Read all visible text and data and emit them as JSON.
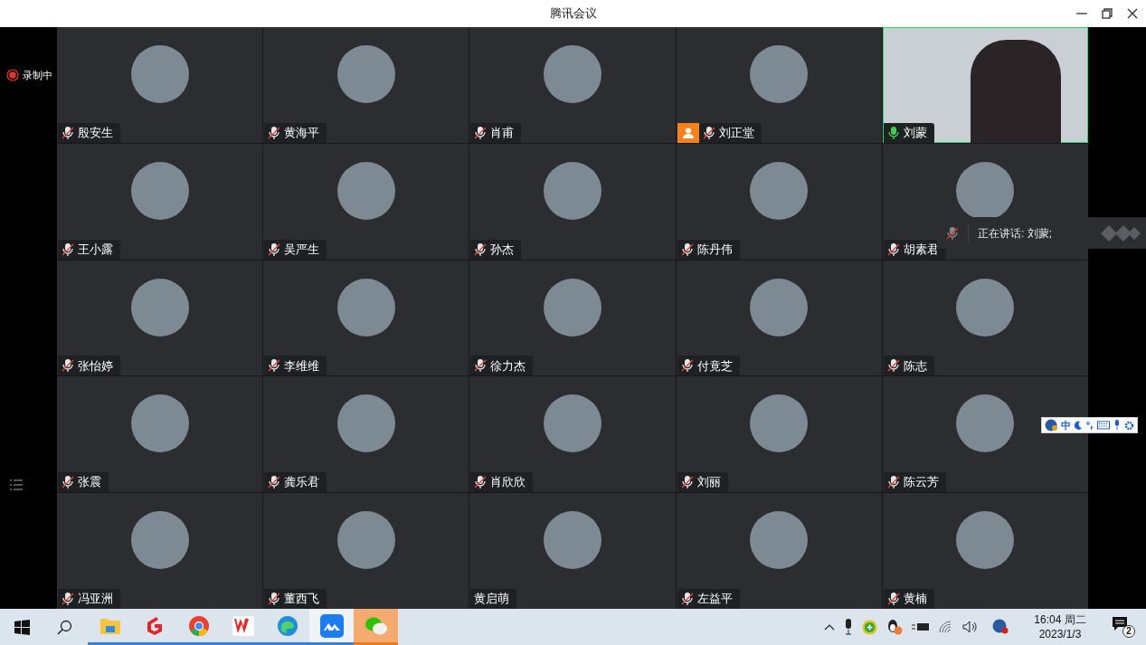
{
  "window": {
    "title": "腾讯会议"
  },
  "recording": {
    "label": "录制中",
    "on": true
  },
  "tiles": [
    {
      "name": "殷安生",
      "kind": "avatar",
      "audio": true,
      "muted": true,
      "host": false,
      "speaking": false
    },
    {
      "name": "黄海平",
      "kind": "avatar",
      "audio": true,
      "muted": true,
      "host": false,
      "speaking": false
    },
    {
      "name": "肖甫",
      "kind": "avatar",
      "audio": true,
      "muted": true,
      "host": false,
      "speaking": false
    },
    {
      "name": "刘正堂",
      "kind": "avatar",
      "audio": true,
      "muted": true,
      "host": true,
      "speaking": false
    },
    {
      "name": "刘蒙",
      "kind": "video",
      "audio": true,
      "muted": false,
      "host": false,
      "speaking": true
    },
    {
      "name": "王小露",
      "kind": "avatar",
      "audio": true,
      "muted": true,
      "host": false,
      "speaking": false
    },
    {
      "name": "吴严生",
      "kind": "avatar",
      "audio": true,
      "muted": true,
      "host": false,
      "speaking": false
    },
    {
      "name": "孙杰",
      "kind": "avatar",
      "audio": true,
      "muted": true,
      "host": false,
      "speaking": false
    },
    {
      "name": "陈丹伟",
      "kind": "avatar",
      "audio": true,
      "muted": true,
      "host": false,
      "speaking": false
    },
    {
      "name": "胡素君",
      "kind": "avatar",
      "audio": true,
      "muted": true,
      "host": false,
      "speaking": false
    },
    {
      "name": "张怡婷",
      "kind": "avatar",
      "audio": true,
      "muted": true,
      "host": false,
      "speaking": false
    },
    {
      "name": "李维维",
      "kind": "avatar",
      "audio": true,
      "muted": true,
      "host": false,
      "speaking": false
    },
    {
      "name": "徐力杰",
      "kind": "avatar",
      "audio": true,
      "muted": true,
      "host": false,
      "speaking": false
    },
    {
      "name": "付竟芝",
      "kind": "avatar",
      "audio": true,
      "muted": true,
      "host": false,
      "speaking": false
    },
    {
      "name": "陈志",
      "kind": "avatar",
      "audio": true,
      "muted": true,
      "host": false,
      "speaking": false
    },
    {
      "name": "张震",
      "kind": "avatar",
      "audio": true,
      "muted": true,
      "host": false,
      "speaking": false
    },
    {
      "name": "龚乐君",
      "kind": "avatar",
      "audio": true,
      "muted": true,
      "host": false,
      "speaking": false
    },
    {
      "name": "肖欣欣",
      "kind": "avatar",
      "audio": true,
      "muted": true,
      "host": false,
      "speaking": false
    },
    {
      "name": "刘丽",
      "kind": "avatar",
      "audio": true,
      "muted": true,
      "host": false,
      "speaking": false
    },
    {
      "name": "陈云芳",
      "kind": "avatar",
      "audio": true,
      "muted": true,
      "host": false,
      "speaking": false
    },
    {
      "name": "冯亚洲",
      "kind": "avatar",
      "audio": true,
      "muted": true,
      "host": false,
      "speaking": false
    },
    {
      "name": "董西飞",
      "kind": "avatar",
      "audio": true,
      "muted": true,
      "host": false,
      "speaking": false
    },
    {
      "name": "黄启萌",
      "kind": "avatar",
      "audio": false,
      "host": false,
      "speaking": false
    },
    {
      "name": "左益平",
      "kind": "avatar",
      "audio": true,
      "muted": true,
      "host": false,
      "speaking": false
    },
    {
      "name": "黄楠",
      "kind": "avatar",
      "audio": true,
      "muted": true,
      "host": false,
      "speaking": false
    }
  ],
  "speaking_banner": {
    "text": "正在讲话: 刘蒙;"
  },
  "ime_toolbar": {
    "mode": "中"
  },
  "taskbar": {
    "apps": [
      {
        "kind": "folder",
        "active": false,
        "alert": false
      },
      {
        "kind": "g-logo",
        "active": false,
        "alert": false
      },
      {
        "kind": "browser",
        "active": false,
        "alert": false
      },
      {
        "kind": "w-logo",
        "active": false,
        "alert": false
      },
      {
        "kind": "swirl",
        "active": false,
        "alert": false
      },
      {
        "kind": "mountain",
        "active": true,
        "alert": false
      },
      {
        "kind": "chat",
        "active": false,
        "alert": true
      }
    ],
    "time": "16:04 周二",
    "date": "2023/1/3",
    "notifications": "2"
  }
}
